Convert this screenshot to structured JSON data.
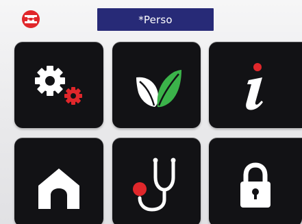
{
  "header": {
    "profile_title": "*Perso",
    "logo_icon": "brand-logo-icon"
  },
  "tiles": [
    {
      "name": "settings",
      "icon": "gears-icon"
    },
    {
      "name": "eco",
      "icon": "leaves-icon"
    },
    {
      "name": "info",
      "icon": "info-icon"
    },
    {
      "name": "home",
      "icon": "home-icon"
    },
    {
      "name": "health",
      "icon": "stethoscope-icon"
    },
    {
      "name": "lock",
      "icon": "padlock-icon"
    }
  ],
  "colors": {
    "title_bar": "#272a77",
    "tile_background": "#121215",
    "accent_red": "#e0272b",
    "leaf_green": "#3bb34a"
  }
}
